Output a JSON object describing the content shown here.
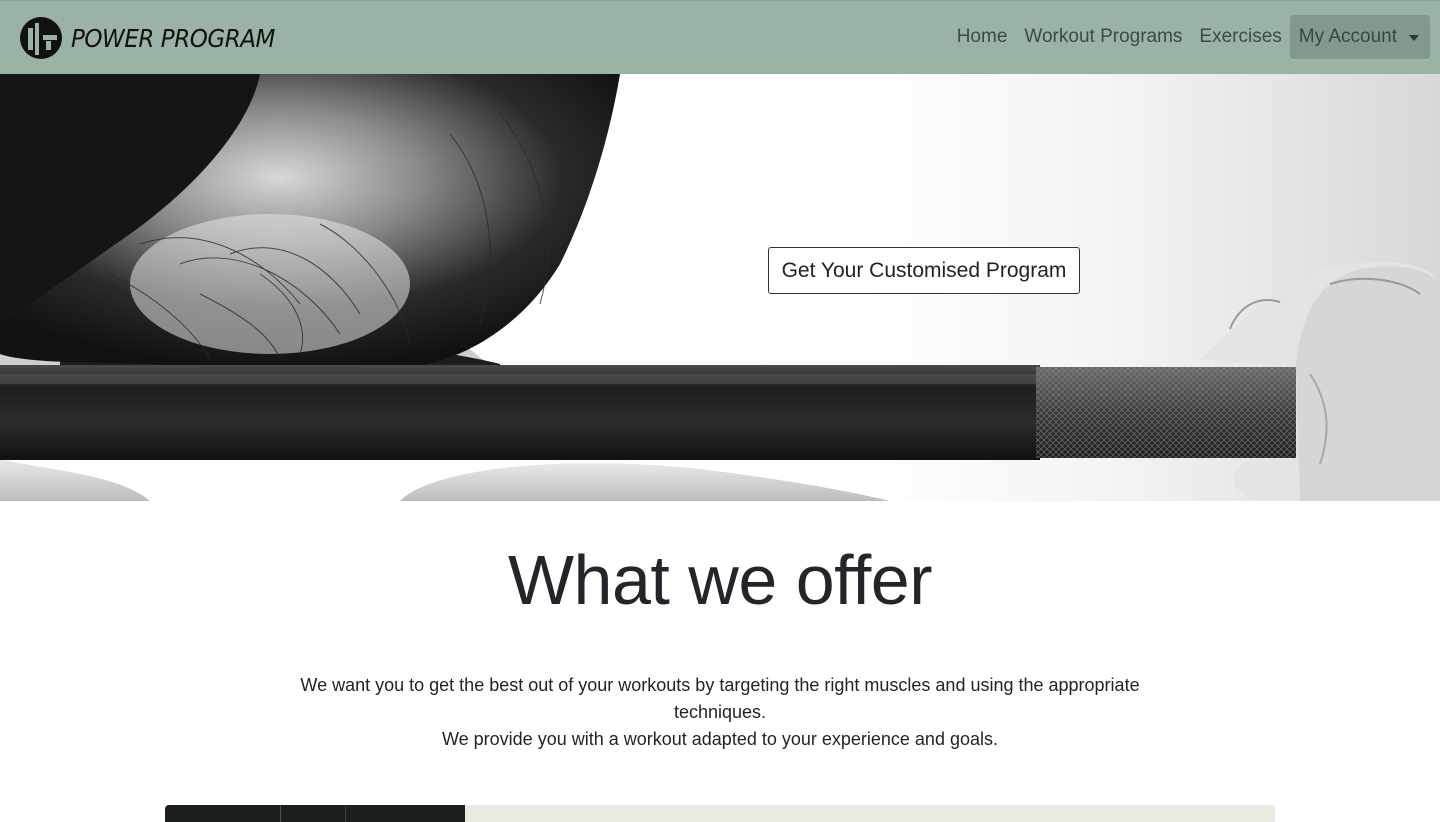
{
  "brand": {
    "name": "POWER PROGRAM",
    "logo_icon": "barbell-logo-icon"
  },
  "nav": {
    "links": [
      {
        "label": "Home"
      },
      {
        "label": "Workout Programs"
      },
      {
        "label": "Exercises"
      }
    ],
    "account": {
      "label": "My Account",
      "icon": "caret-down-icon"
    }
  },
  "hero": {
    "cta_label": "Get Your Customised Program",
    "image_subject": "woman-lifting-barbell-photo"
  },
  "offer": {
    "title": "What we offer",
    "line1": "We want you to get the best out of your workouts by targeting the right muscles and using the appropriate techniques.",
    "line2": "We provide you with a workout adapted to your experience and goals."
  },
  "colors": {
    "navbar": "#9bb3a4",
    "dropdown": "#83998c",
    "card": "#e9ebe0"
  }
}
